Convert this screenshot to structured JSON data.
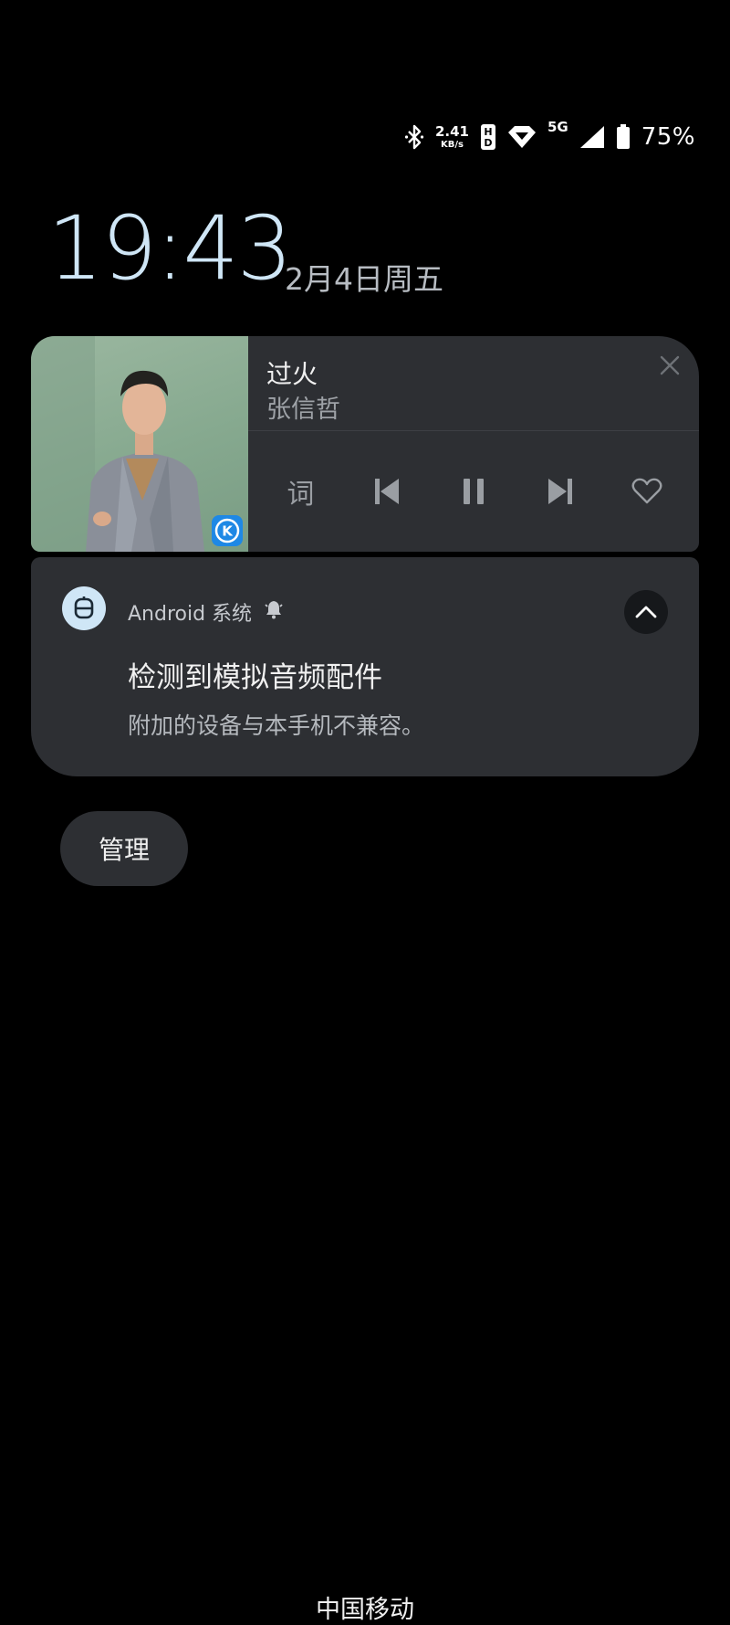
{
  "status_bar": {
    "net_speed_value": "2.41",
    "net_speed_unit": "KB/s",
    "network_type": "5G",
    "battery_percent": "75%",
    "icons": [
      "bluetooth-icon",
      "hd-icon",
      "wifi-icon",
      "cellular-signal-icon",
      "battery-icon"
    ]
  },
  "lockscreen": {
    "time": "19:43",
    "date": "2月4日周五"
  },
  "music": {
    "title": "过火",
    "artist": "张信哲",
    "lyrics_label": "词",
    "app_badge_letter": "K",
    "controls": [
      "lyrics",
      "previous-icon",
      "pause-icon",
      "next-icon",
      "heart-icon"
    ]
  },
  "notification": {
    "app_name": "Android 系统",
    "app_icon": "android-system-icon",
    "title": "检测到模拟音频配件",
    "text": "附加的设备与本手机不兼容。"
  },
  "actions": {
    "manage_label": "管理"
  },
  "carrier": {
    "name": "中国移动"
  },
  "colors": {
    "background": "#000000",
    "card": "#2d2f33",
    "clock": "#cfe6f6",
    "badge_blue": "#1e88e5"
  }
}
